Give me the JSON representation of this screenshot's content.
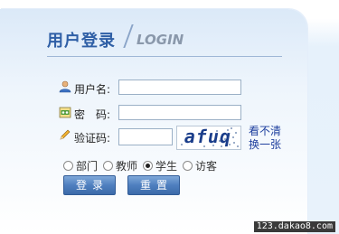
{
  "header": {
    "title_cn": "用户登录",
    "title_en": "LOGIN"
  },
  "form": {
    "username_label": "用户名:",
    "username_value": "",
    "password_label": "密　码:",
    "password_value": "",
    "captcha_label": "验证码:",
    "captcha_value": "",
    "captcha_image_text": "afuq",
    "refresh_line1": "看不清",
    "refresh_line2": "换一张"
  },
  "roles": {
    "options": [
      {
        "label": "部门",
        "checked": false
      },
      {
        "label": "教师",
        "checked": false
      },
      {
        "label": "学生",
        "checked": true
      },
      {
        "label": "访客",
        "checked": false
      }
    ]
  },
  "buttons": {
    "login": "登录",
    "reset": "重置"
  },
  "watermark": "123.dakao8.com",
  "icons": {
    "user": "user-icon",
    "password": "key-icon",
    "captcha": "pencil-icon"
  },
  "colors": {
    "title": "#2f5fa6",
    "button": "#4f7fbf",
    "link": "#1e3f9e"
  }
}
